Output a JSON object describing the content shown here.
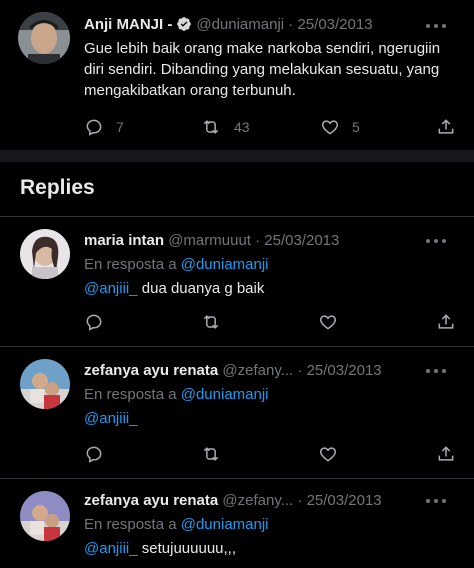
{
  "main_tweet": {
    "author_name": "Anji MANJI -",
    "handle": "@duniamanji",
    "separator": "·",
    "date": "25/03/2013",
    "text": "Gue lebih baik orang make narkoba sendiri, ngerugiin diri sendiri. Dibanding yang melakukan sesuatu, yang mengakibatkan orang terbunuh.",
    "reply_count": "7",
    "retweet_count": "43",
    "like_count": "5"
  },
  "replies_section": {
    "title": "Replies"
  },
  "replies": [
    {
      "author_name": "maria intan",
      "handle": "@marmuuut",
      "separator": "·",
      "date": "25/03/2013",
      "reply_prefix": "En resposta a",
      "reply_to": "@duniamanji",
      "mention": "@anjiii_",
      "text": " dua duanya g baik"
    },
    {
      "author_name": "zefanya ayu renata",
      "handle": "@zefany...",
      "separator": "·",
      "date": "25/03/2013",
      "reply_prefix": "En resposta a",
      "reply_to": "@duniamanji",
      "mention": "@anjiii_",
      "text": ""
    },
    {
      "author_name": "zefanya ayu renata",
      "handle": "@zefany...",
      "separator": "·",
      "date": "25/03/2013",
      "reply_prefix": "En resposta a",
      "reply_to": "@duniamanji",
      "mention": "@anjiii_",
      "text": " setujuuuuuu,,,"
    }
  ],
  "colors": {
    "background": "#000000",
    "text": "#e7e9ea",
    "muted": "#71767b",
    "link": "#1d9bf0",
    "divider": "#2f3336",
    "verified": "#d9d9d9"
  },
  "icons": [
    "verified-badge-icon",
    "more-icon",
    "reply-icon",
    "retweet-icon",
    "like-icon",
    "share-icon"
  ]
}
